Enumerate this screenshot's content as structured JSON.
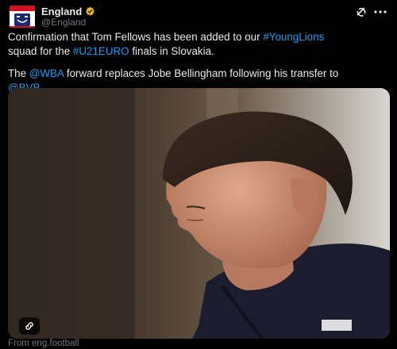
{
  "account": {
    "display_name": "England",
    "handle": "@England"
  },
  "post": {
    "line1_pre": "Confirmation that Tom Fellows has been added to our ",
    "hashtag_younglions": "#YoungLions",
    "line2_pre": "squad for the ",
    "hashtag_u21euro": "#U21EURO",
    "line2_post": " finals in Slovakia.",
    "p2_pre": "The ",
    "mention_wba": "@WBA",
    "p2_mid": " forward replaces Jobe Bellingham following his transfer to",
    "mention_bvb": "@BVB",
    "p2_post": "."
  },
  "card": {
    "source": "From eng.football"
  },
  "icons": {
    "verified": "verified-badge-icon",
    "grok": "grok-icon",
    "more": "more-options-icon",
    "link": "link-icon"
  },
  "colors": {
    "background": "#000000",
    "text": "#e7e9ea",
    "secondary": "#71767b",
    "link": "#1d9bf0",
    "verified": "#e2b719"
  }
}
